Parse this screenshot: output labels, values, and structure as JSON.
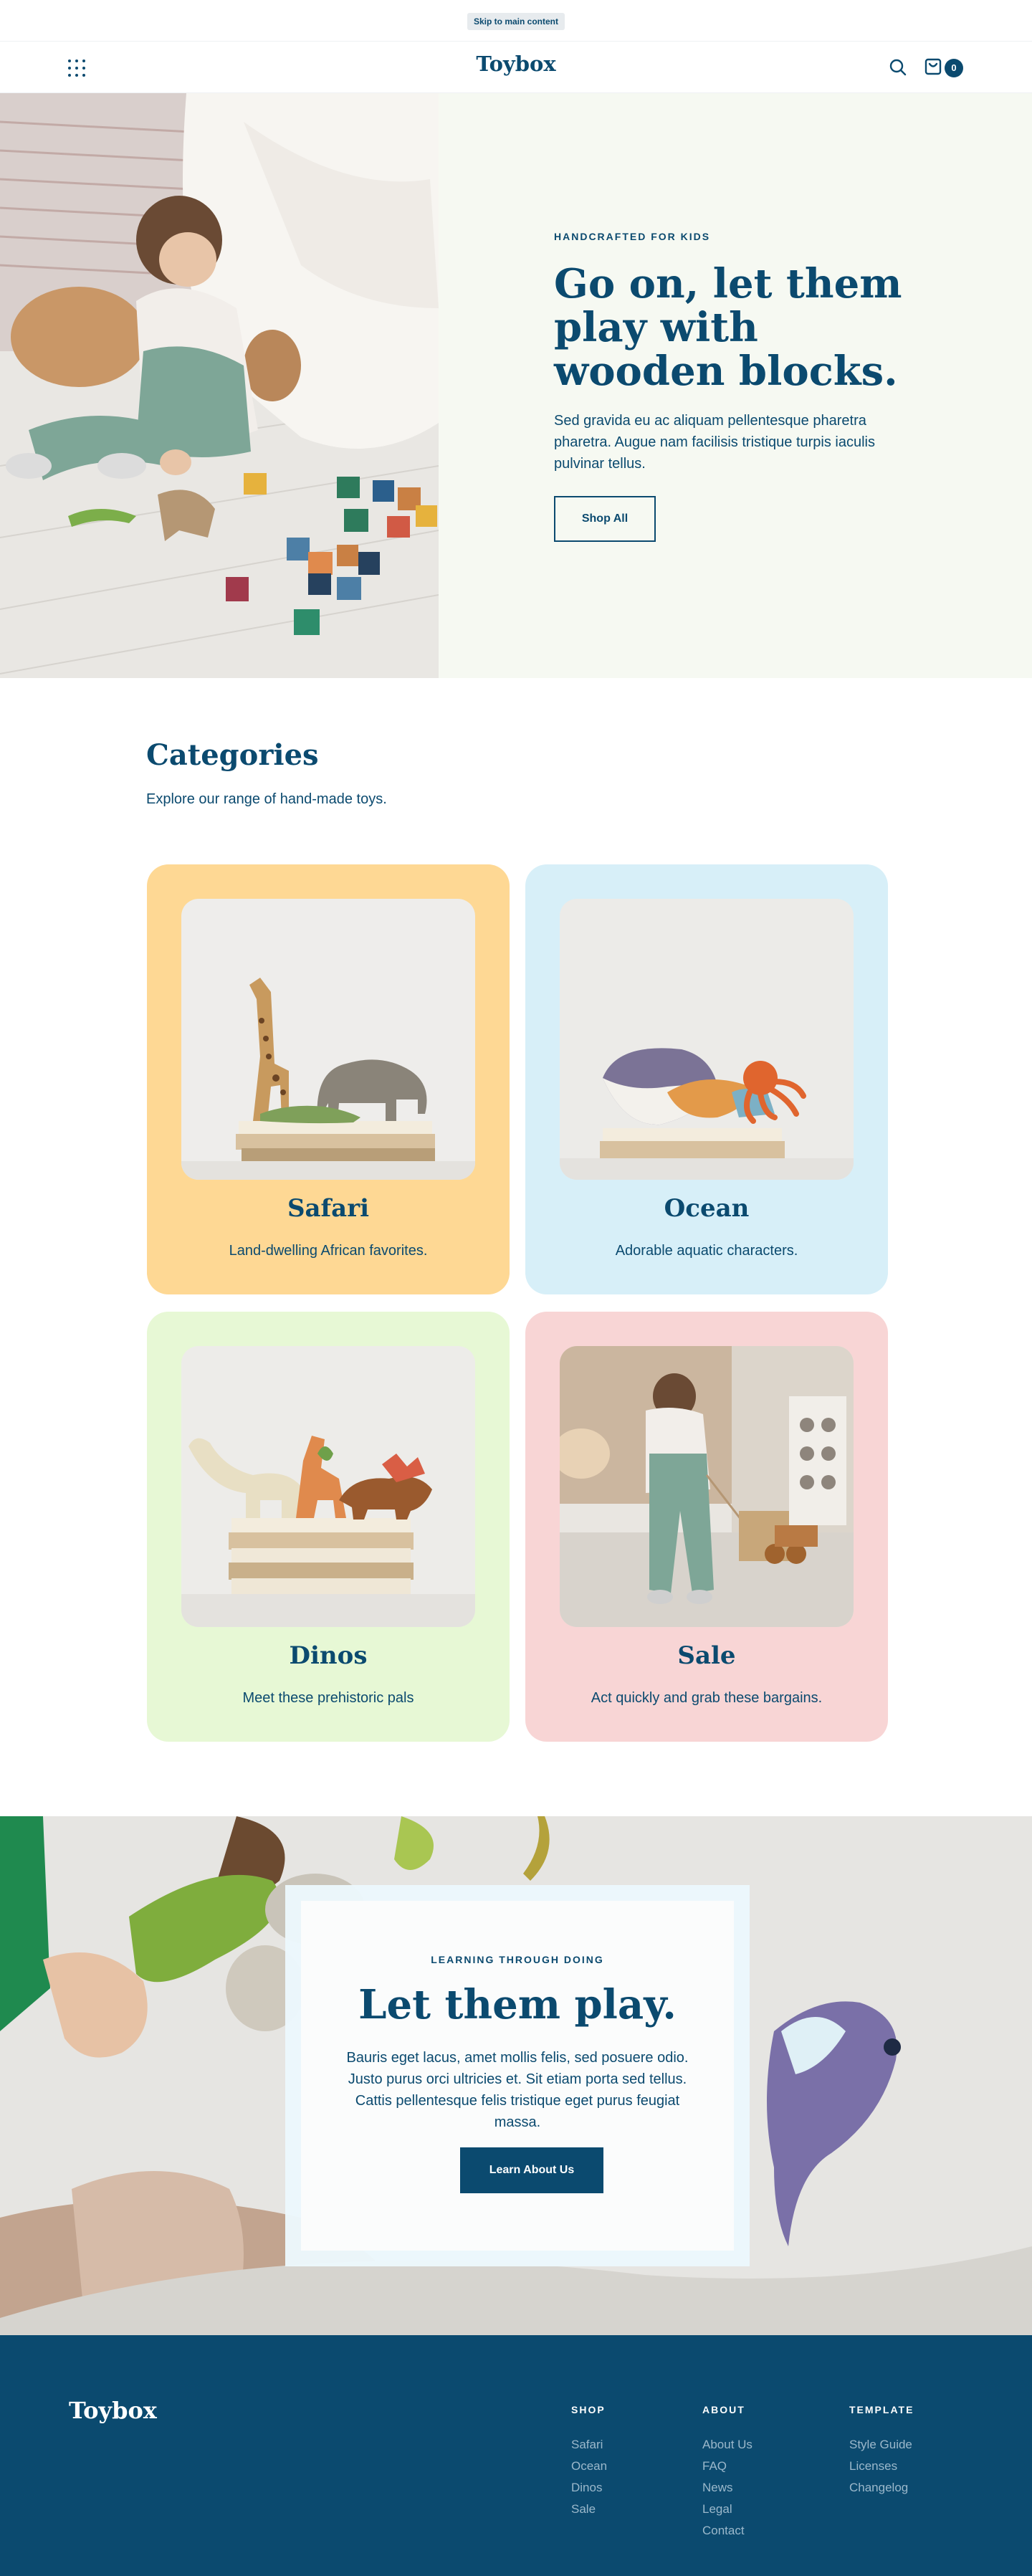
{
  "skip_link": "Skip to main content",
  "header": {
    "logo": "Toybox",
    "cart_count": "0"
  },
  "hero": {
    "eyebrow": "HANDCRAFTED FOR KIDS",
    "title": "Go on, let them play with wooden blocks.",
    "text": "Sed gravida eu ac aliquam pellentesque pharetra pharetra. Augue nam facilisis tristique turpis iaculis pulvinar tellus.",
    "button": "Shop All"
  },
  "categories": {
    "title": "Categories",
    "subtitle": "Explore our range of hand-made toys.",
    "items": [
      {
        "title": "Safari",
        "desc": "Land-dwelling African favorites.",
        "color": "#fed894"
      },
      {
        "title": "Ocean",
        "desc": "Adorable aquatic characters.",
        "color": "#d7eff8"
      },
      {
        "title": "Dinos",
        "desc": "Meet these prehistoric pals",
        "color": "#e7f8d5"
      },
      {
        "title": "Sale",
        "desc": "Act quickly and grab these bargains.",
        "color": "#f8d5d5"
      }
    ]
  },
  "promo": {
    "eyebrow": "LEARNING THROUGH DOING",
    "title": "Let them play.",
    "text": "Bauris eget lacus, amet mollis felis, sed posuere odio. Justo purus orci ultricies et. Sit etiam porta sed tellus. Cattis pellentesque felis tristique eget purus feugiat massa.",
    "button": "Learn About Us"
  },
  "footer": {
    "logo": "Toybox",
    "columns": [
      {
        "title": "SHOP",
        "links": [
          "Safari",
          "Ocean",
          "Dinos",
          "Sale"
        ]
      },
      {
        "title": "ABOUT",
        "links": [
          "About Us",
          "FAQ",
          "News",
          "Legal",
          "Contact"
        ]
      },
      {
        "title": "TEMPLATE",
        "links": [
          "Style Guide",
          "Licenses",
          "Changelog"
        ]
      }
    ]
  },
  "colors": {
    "brand": "#0b4a6f",
    "hero_bg": "#f6f9f2",
    "footer_link": "#9bb8cb"
  },
  "icons": [
    "grid-menu-icon",
    "search-icon",
    "shopping-bag-icon"
  ]
}
